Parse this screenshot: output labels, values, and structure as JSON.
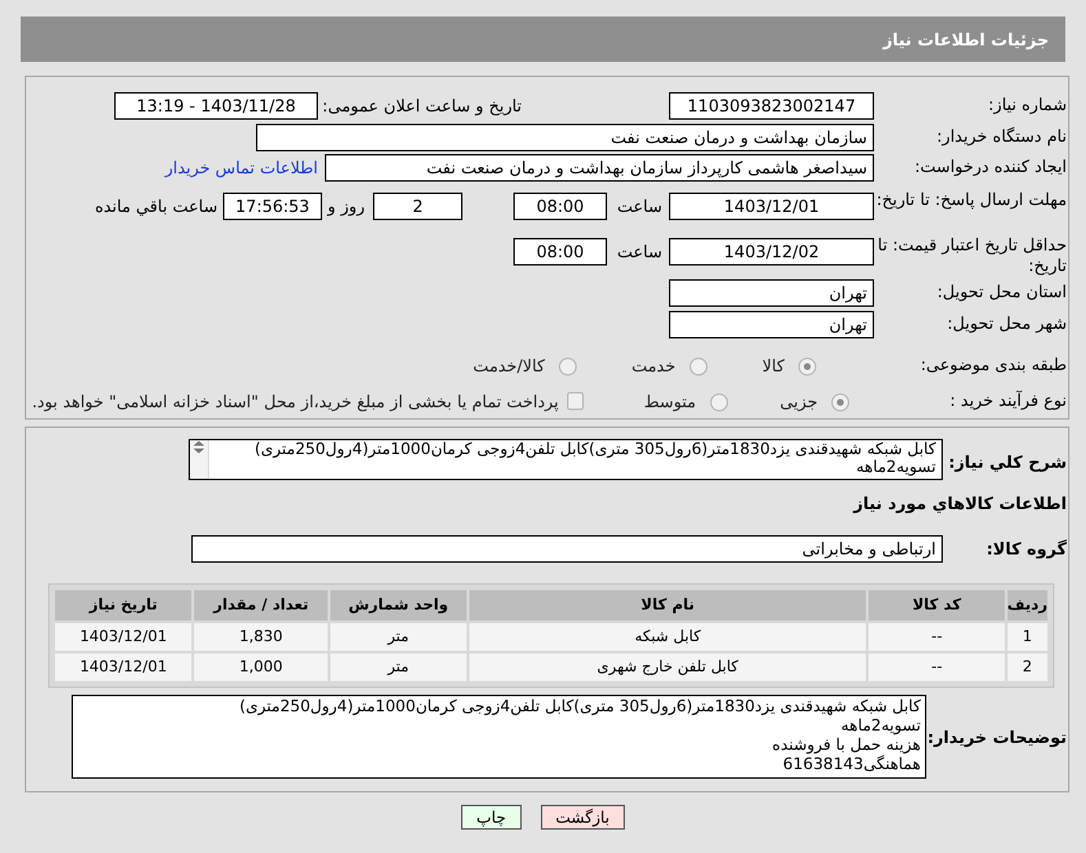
{
  "header": {
    "title": "جزئیات اطلاعات نیاز"
  },
  "need_number": {
    "label": "شماره نیاز:",
    "value": "1103093823002147"
  },
  "announce": {
    "label": "تاریخ و ساعت اعلان عمومی:",
    "value": "1403/11/28 - 13:19"
  },
  "buyer_org": {
    "label": "نام دستگاه خریدار:",
    "value": "سازمان بهداشت و درمان صنعت نفت"
  },
  "requester": {
    "label": "ایجاد کننده درخواست:",
    "value": "سیداصغر هاشمی کارپرداز سازمان بهداشت و درمان صنعت نفت",
    "link": "اطلاعات تماس خریدار"
  },
  "reply_deadline": {
    "label": "مهلت ارسال پاسخ: تا تاریخ:",
    "date": "1403/12/01",
    "time_label": "ساعت",
    "time": "08:00",
    "days": "2",
    "days_label": "روز و",
    "remaining": "17:56:53",
    "remaining_label": "ساعت باقي مانده"
  },
  "price_validity": {
    "label": "حداقل تاریخ اعتبار قیمت: تا تاریخ:",
    "date": "1403/12/02",
    "time_label": "ساعت",
    "time": "08:00"
  },
  "province": {
    "label": "استان محل تحویل:",
    "value": "تهران"
  },
  "city": {
    "label": "شهر محل تحویل:",
    "value": "تهران"
  },
  "category": {
    "label": "طبقه بندی موضوعی:",
    "options": [
      {
        "label": "کالا",
        "selected": true
      },
      {
        "label": "خدمت",
        "selected": false
      },
      {
        "label": "کالا/خدمت",
        "selected": false
      }
    ]
  },
  "process": {
    "label": "نوع فرآیند خرید :",
    "options": [
      {
        "label": "جزیی",
        "selected": true
      },
      {
        "label": "متوسط",
        "selected": false
      }
    ],
    "treasury": {
      "label": "پرداخت تمام یا بخشی از مبلغ خرید،از محل \"اسناد خزانه اسلامی\" خواهد بود.",
      "checked": false
    }
  },
  "description": {
    "label": "شرح کلي نياز:",
    "lines": [
      "کابل شبکه شهیدقندی یزد1830متر(6رول305 متری)کابل تلفن4زوجی کرمان1000متر(4رول250متری)",
      "تسویه2ماهه"
    ]
  },
  "goods_title": "اطلاعات کالاهاي مورد نياز",
  "goods_group": {
    "label": "گروه کالا:",
    "value": "ارتباطی و مخابراتی"
  },
  "table": {
    "columns": [
      "ردیف",
      "کد کالا",
      "نام کالا",
      "واحد شمارش",
      "تعداد / مقدار",
      "تاریخ نیاز"
    ],
    "rows": [
      [
        "1",
        "--",
        "کابل شبکه",
        "متر",
        "1,830",
        "1403/12/01"
      ],
      [
        "2",
        "--",
        "کابل تلفن خارج شهری",
        "متر",
        "1,000",
        "1403/12/01"
      ]
    ]
  },
  "buyer_notes": {
    "label": "توضیحات خریدار:",
    "lines": [
      "کابل شبکه شهیدقندی یزد1830متر(6رول305 متری)کابل تلفن4زوجی کرمان1000متر(4رول250متری)",
      "تسویه2ماهه",
      "هزینه حمل با فروشنده",
      "هماهنگی61638143"
    ]
  },
  "buttons": [
    {
      "kind": "back",
      "label": "بازگشت"
    },
    {
      "kind": "print",
      "label": "چاپ"
    }
  ]
}
